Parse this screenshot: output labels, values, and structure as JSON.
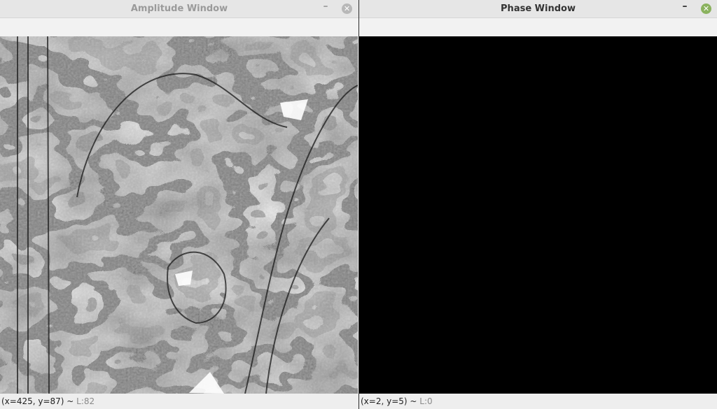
{
  "windows": {
    "amplitude": {
      "title": "Amplitude Window",
      "minimize_icon": "minimize-icon",
      "close_icon": "close-icon",
      "status": {
        "coords": "(x=425, y=87) ~",
        "level": " L:82"
      }
    },
    "phase": {
      "title": "Phase Window",
      "minimize_icon": "minimize-icon",
      "close_icon": "close-icon",
      "status": {
        "coords": "(x=2, y=5) ~",
        "level": " L:0"
      }
    }
  },
  "colors": {
    "phase_background": "#000000",
    "close_active": "#8ab25e",
    "close_inactive": "#b8b8b8"
  }
}
